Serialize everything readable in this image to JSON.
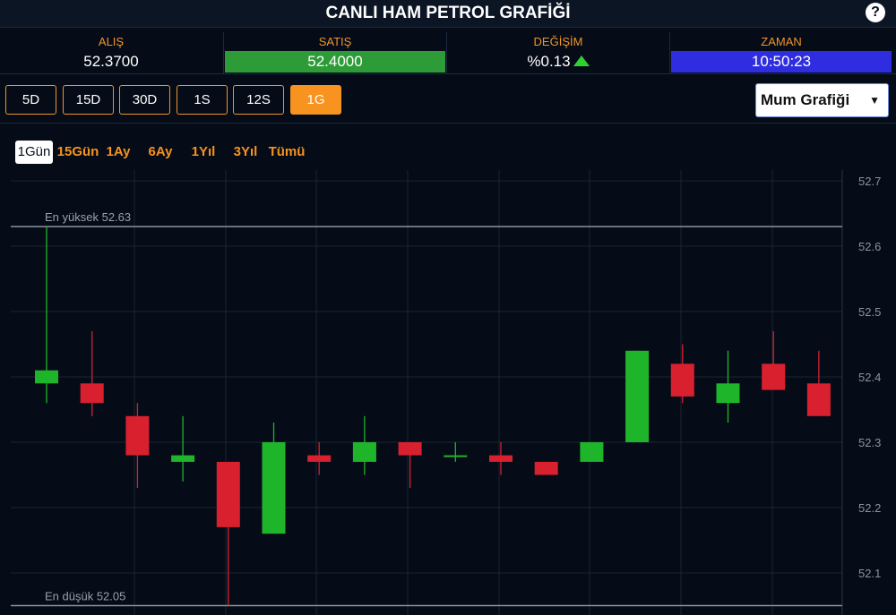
{
  "header": {
    "title": "CANLI HAM PETROL GRAFİĞİ",
    "help_label": "?"
  },
  "stats": {
    "buy": {
      "label": "ALIŞ",
      "value": "52.3700"
    },
    "sell": {
      "label": "SATIŞ",
      "value": "52.4000"
    },
    "change": {
      "label": "DEĞİŞİM",
      "value": "%0.13",
      "direction": "up"
    },
    "time": {
      "label": "ZAMAN",
      "value": "10:50:23"
    }
  },
  "periods": [
    "5D",
    "15D",
    "30D",
    "1S",
    "12S",
    "1G"
  ],
  "active_period": "1G",
  "chart_type_select": {
    "value": "Mum Grafiği",
    "chevron": "▼"
  },
  "ranges": [
    "1Gün",
    "15Gün",
    "1Ay",
    "6Ay",
    "1Yıl",
    "3Yıl",
    "Tümü"
  ],
  "active_range": "1Gün",
  "colors": {
    "up": "#1fb52b",
    "down": "#d8202f",
    "accent": "#f7931e",
    "background": "#050c17"
  },
  "chart_data": {
    "type": "candlestick",
    "high_label": "En yüksek 52.63",
    "low_label": "En düşük 52.05",
    "high_value": 52.63,
    "low_value": 52.05,
    "ylim": [
      52.05,
      52.7
    ],
    "yticks": [
      52.1,
      52.2,
      52.3,
      52.4,
      52.5,
      52.6,
      52.7
    ],
    "grid": true,
    "candles": [
      {
        "open": 52.39,
        "close": 52.41,
        "high": 52.63,
        "low": 52.36
      },
      {
        "open": 52.39,
        "close": 52.36,
        "high": 52.47,
        "low": 52.34
      },
      {
        "open": 52.34,
        "close": 52.28,
        "high": 52.36,
        "low": 52.23
      },
      {
        "open": 52.27,
        "close": 52.28,
        "high": 52.34,
        "low": 52.24
      },
      {
        "open": 52.27,
        "close": 52.17,
        "high": 52.27,
        "low": 52.05
      },
      {
        "open": 52.16,
        "close": 52.3,
        "high": 52.33,
        "low": 52.16
      },
      {
        "open": 52.28,
        "close": 52.27,
        "high": 52.3,
        "low": 52.25
      },
      {
        "open": 52.27,
        "close": 52.3,
        "high": 52.34,
        "low": 52.25
      },
      {
        "open": 52.3,
        "close": 52.28,
        "high": 52.3,
        "low": 52.23
      },
      {
        "open": 52.28,
        "close": 52.28,
        "high": 52.3,
        "low": 52.27
      },
      {
        "open": 52.28,
        "close": 52.27,
        "high": 52.3,
        "low": 52.25
      },
      {
        "open": 52.27,
        "close": 52.25,
        "high": 52.27,
        "low": 52.25
      },
      {
        "open": 52.27,
        "close": 52.3,
        "high": 52.3,
        "low": 52.27
      },
      {
        "open": 52.3,
        "close": 52.44,
        "high": 52.44,
        "low": 52.3
      },
      {
        "open": 52.42,
        "close": 52.37,
        "high": 52.45,
        "low": 52.36
      },
      {
        "open": 52.36,
        "close": 52.39,
        "high": 52.44,
        "low": 52.33
      },
      {
        "open": 52.42,
        "close": 52.38,
        "high": 52.47,
        "low": 52.38
      },
      {
        "open": 52.39,
        "close": 52.34,
        "high": 52.44,
        "low": 52.34
      }
    ]
  }
}
